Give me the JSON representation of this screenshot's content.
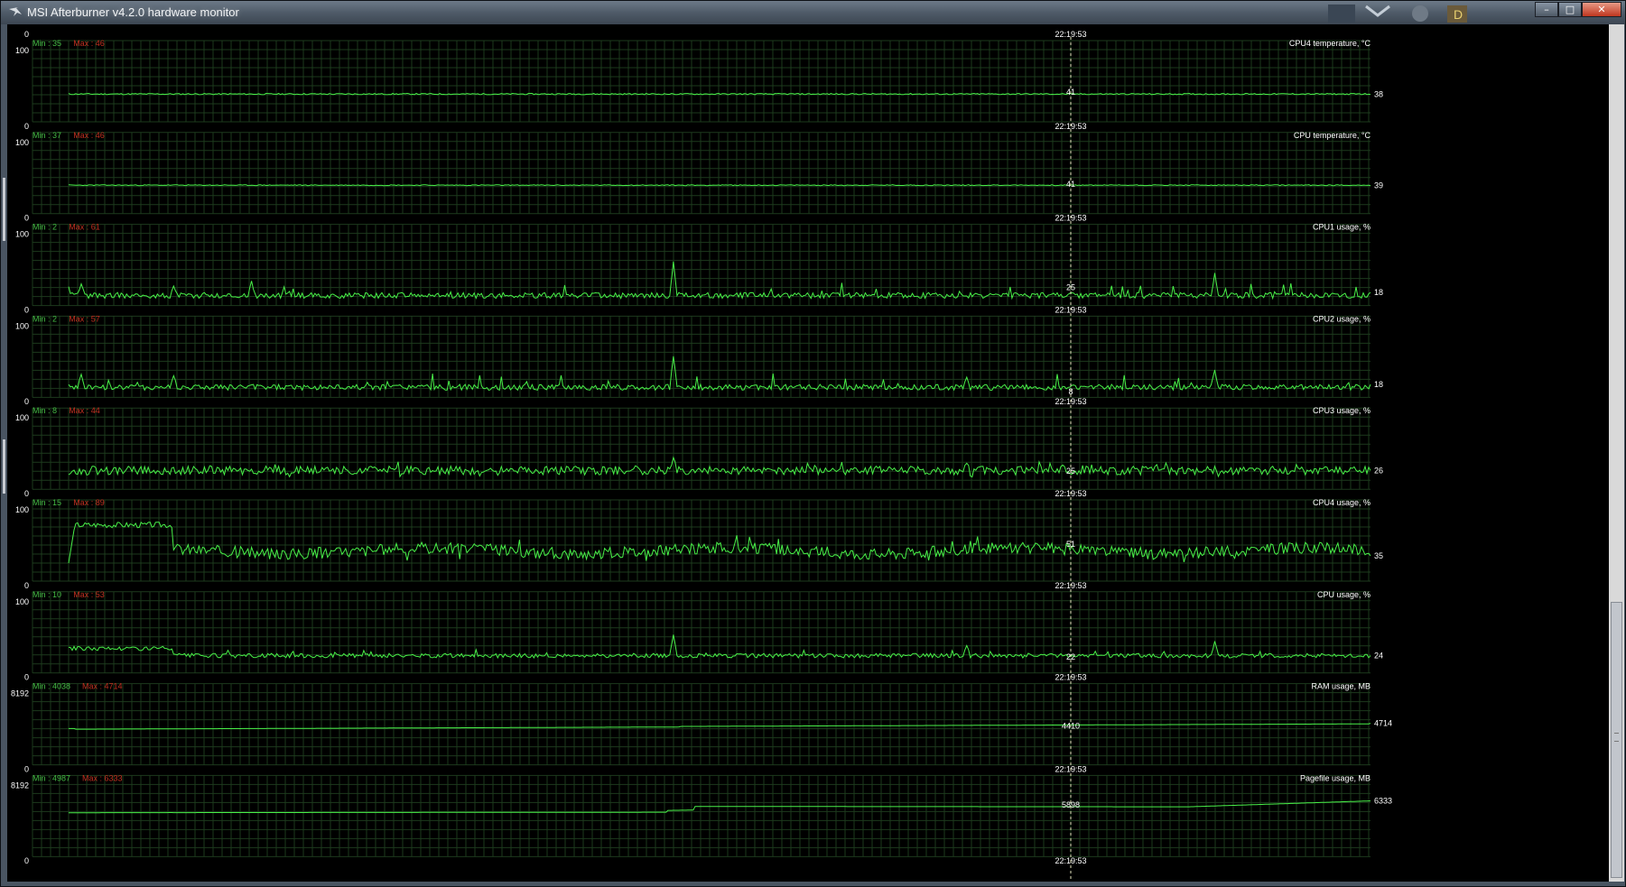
{
  "window": {
    "title": "MSI Afterburner v4.2.0 hardware monitor",
    "buttons": {
      "minimize": "–",
      "maximize": "□",
      "close": "✕"
    }
  },
  "cursor_time": "22:19:53",
  "colors": {
    "background": "#000000",
    "grid": "#1d3a1d",
    "trace": "#48f048",
    "min_label": "#44bb44",
    "max_label": "#c03020",
    "text": "#ffffff"
  },
  "graphs": [
    {
      "name": "CPU4 temperature, °C",
      "ymax_label": "100",
      "ymin_label": "0",
      "ylim": [
        0,
        100
      ],
      "min": "Min : 35",
      "max": "Max : 46",
      "cursor_value": "41",
      "current_value": "38",
      "shape": "flat",
      "mean": 38.5,
      "noise": 0.9,
      "seed": 11
    },
    {
      "name": "CPU temperature, °C",
      "ymax_label": "100",
      "ymin_label": "0",
      "ylim": [
        0,
        100
      ],
      "min": "Min : 37",
      "max": "Max : 46",
      "cursor_value": "41",
      "current_value": "39",
      "shape": "flat",
      "mean": 39.5,
      "noise": 0.6,
      "seed": 23
    },
    {
      "name": "CPU1 usage, %",
      "ymax_label": "100",
      "ymin_label": "0",
      "ylim": [
        0,
        100
      ],
      "min": "Min : 2",
      "max": "Max : 61",
      "cursor_value": "25",
      "current_value": "18",
      "shape": "spiky",
      "mean": 14,
      "noise": 4,
      "seed": 37,
      "peaks": [
        [
          0.08,
          27
        ],
        [
          0.14,
          34
        ],
        [
          0.465,
          61
        ],
        [
          0.88,
          45
        ],
        [
          0.01,
          30
        ]
      ]
    },
    {
      "name": "CPU2 usage, %",
      "ymax_label": "100",
      "ymin_label": "0",
      "ylim": [
        0,
        100
      ],
      "min": "Min : 2",
      "max": "Max : 57",
      "cursor_value": "8",
      "current_value": "18",
      "shape": "spiky",
      "mean": 14,
      "noise": 4,
      "seed": 41,
      "peaks": [
        [
          0.08,
          30
        ],
        [
          0.465,
          57
        ],
        [
          0.69,
          28
        ],
        [
          0.88,
          38
        ],
        [
          0.01,
          32
        ]
      ]
    },
    {
      "name": "CPU3 usage, %",
      "ymax_label": "100",
      "ymin_label": "0",
      "ylim": [
        0,
        100
      ],
      "min": "Min : 8",
      "max": "Max : 44",
      "cursor_value": "25",
      "current_value": "26",
      "shape": "busy",
      "mean": 26,
      "noise": 6,
      "seed": 53,
      "peaks": [
        [
          0.465,
          44
        ],
        [
          0.69,
          36
        ]
      ]
    },
    {
      "name": "CPU4 usage, %",
      "ymax_label": "100",
      "ymin_label": "0",
      "ylim": [
        0,
        100
      ],
      "min": "Min : 15",
      "max": "Max : 89",
      "cursor_value": "51",
      "current_value": "35",
      "shape": "cpu4",
      "mean": 42,
      "noise": 8,
      "seed": 67
    },
    {
      "name": "CPU usage, %",
      "ymax_label": "100",
      "ymin_label": "0",
      "ylim": [
        0,
        100
      ],
      "min": "Min : 10",
      "max": "Max : 53",
      "cursor_value": "22",
      "current_value": "24",
      "shape": "cpuavg",
      "mean": 24,
      "noise": 3,
      "seed": 79,
      "peaks": [
        [
          0.465,
          53
        ],
        [
          0.69,
          38
        ],
        [
          0.88,
          44
        ]
      ]
    },
    {
      "name": "RAM usage, MB",
      "ymax_label": "8192",
      "ymin_label": "0",
      "ylim": [
        0,
        8192
      ],
      "min": "Min : 4038",
      "max": "Max : 4714",
      "cursor_value": "4410",
      "current_value": "4714",
      "shape": "ram"
    },
    {
      "name": "Pagefile usage, MB",
      "ymax_label": "8192",
      "ymin_label": "0",
      "ylim": [
        0,
        8192
      ],
      "min": "Min : 4987",
      "max": "Max : 6333",
      "cursor_value": "5898",
      "current_value": "6333",
      "shape": "pagefile"
    }
  ]
}
